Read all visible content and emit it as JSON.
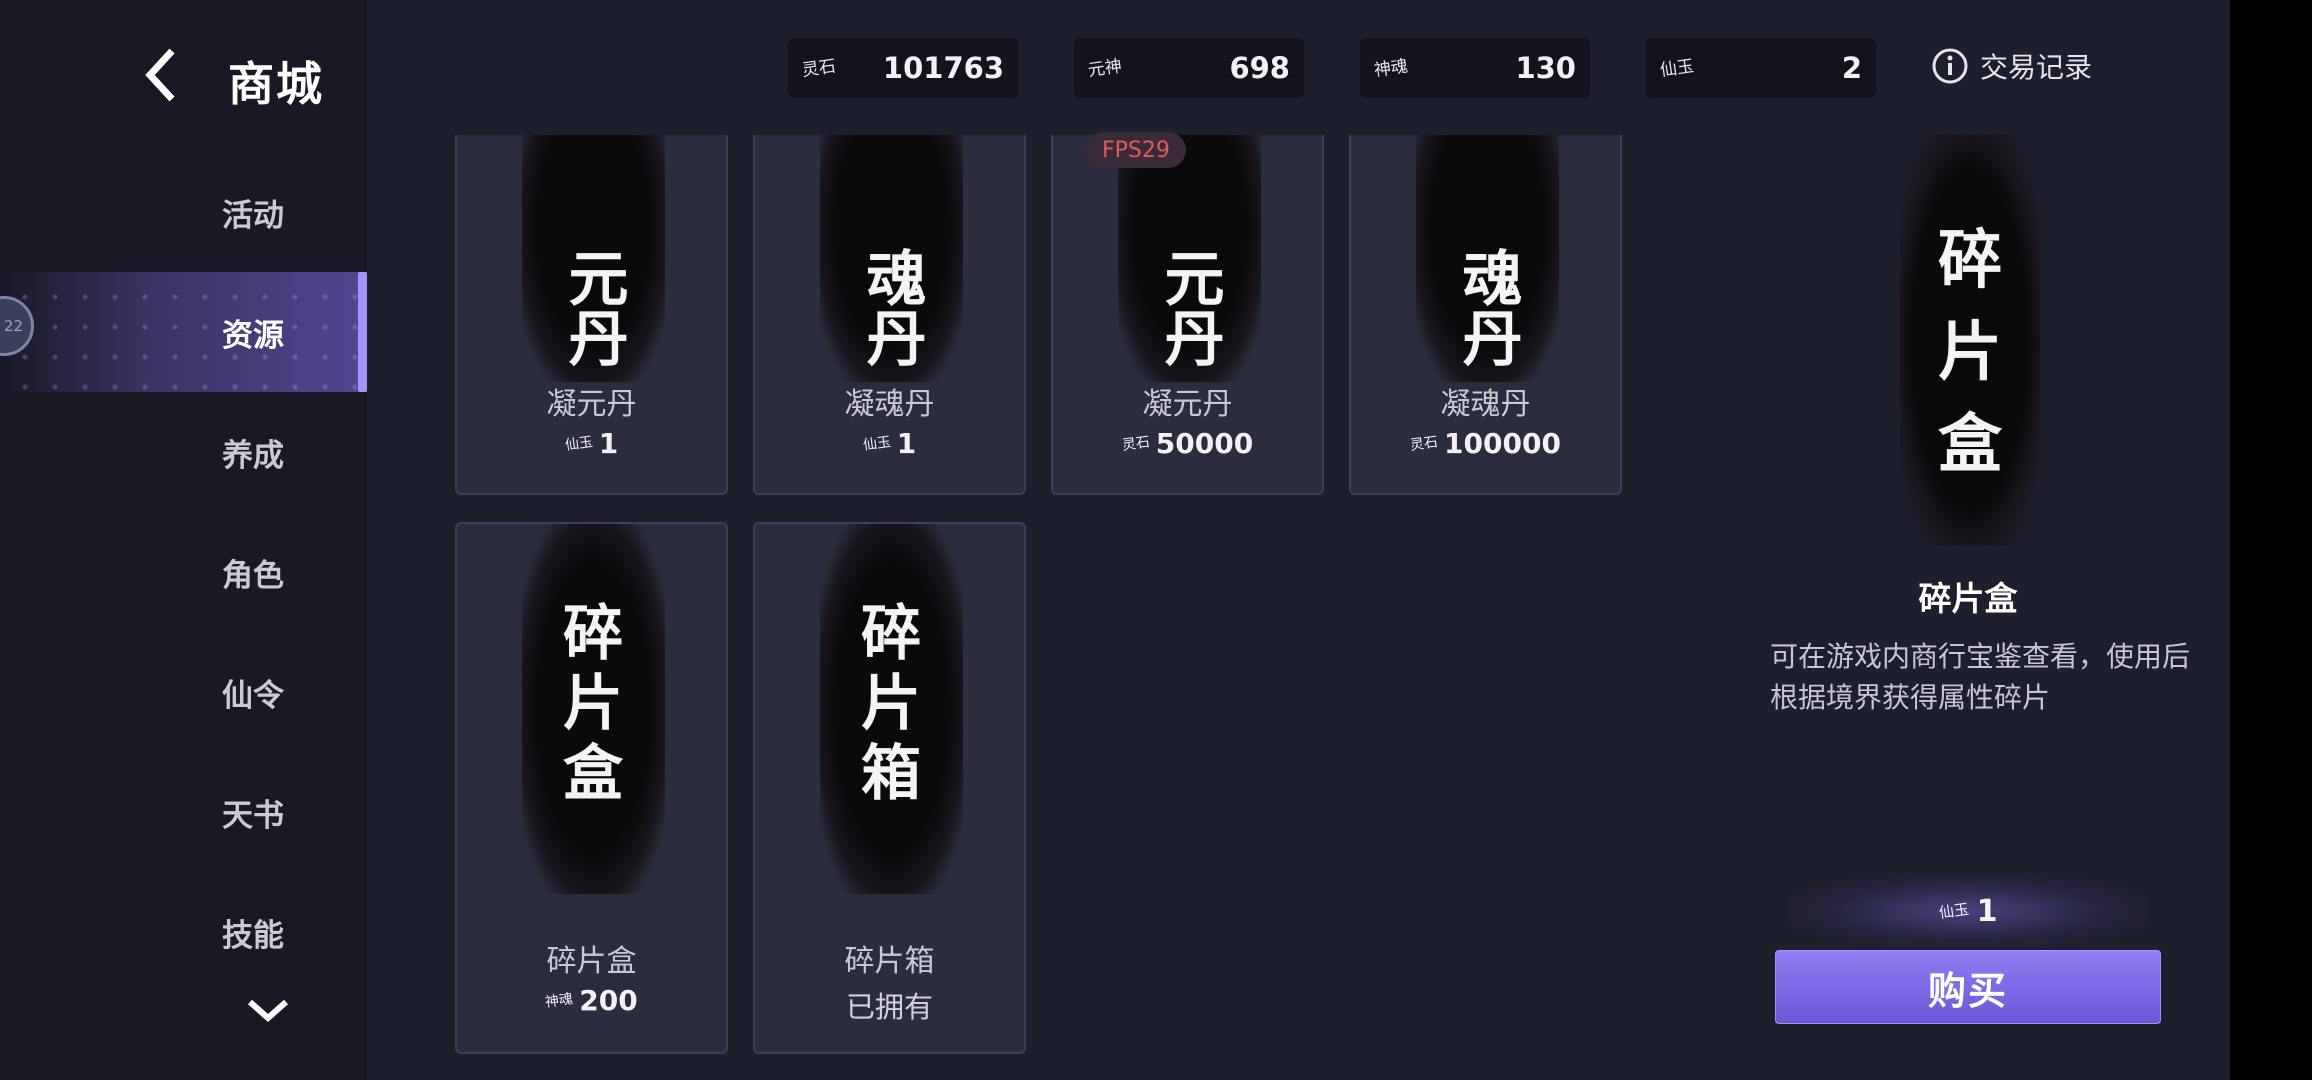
{
  "header": {
    "title": "商城",
    "history_label": "交易记录"
  },
  "currencies": [
    {
      "icon_text": "灵石",
      "value": "101763"
    },
    {
      "icon_text": "元神",
      "value": "698"
    },
    {
      "icon_text": "神魂",
      "value": "130"
    },
    {
      "icon_text": "仙玉",
      "value": "2"
    }
  ],
  "sidebar": {
    "level": "22",
    "items": [
      {
        "label": "活动",
        "active": false
      },
      {
        "label": "资源",
        "active": true
      },
      {
        "label": "养成",
        "active": false
      },
      {
        "label": "角色",
        "active": false
      },
      {
        "label": "仙令",
        "active": false
      },
      {
        "label": "天书",
        "active": false
      },
      {
        "label": "技能",
        "active": false
      }
    ]
  },
  "fps_label": "FPS29",
  "items": [
    {
      "banner": "元丹",
      "name": "凝元丹",
      "price_icon": "仙玉",
      "price": "1"
    },
    {
      "banner": "魂丹",
      "name": "凝魂丹",
      "price_icon": "仙玉",
      "price": "1"
    },
    {
      "banner": "元丹",
      "name": "凝元丹",
      "price_icon": "灵石",
      "price": "50000"
    },
    {
      "banner": "魂丹",
      "name": "凝魂丹",
      "price_icon": "灵石",
      "price": "100000"
    },
    {
      "banner": "碎片盒",
      "name": "碎片盒",
      "price_icon": "神魂",
      "price": "200"
    },
    {
      "banner": "碎片箱",
      "name": "碎片箱",
      "owned": "已拥有"
    }
  ],
  "detail": {
    "banner": "碎片盒",
    "name": "碎片盒",
    "description": "可在游戏内商行宝鉴查看，使用后根据境界获得属性碎片",
    "price_icon": "仙玉",
    "price": "1",
    "buy_label": "购买"
  },
  "colors": {
    "accent": "#7b68ee",
    "background": "#1e1f2c",
    "sidebar": "#181924"
  }
}
